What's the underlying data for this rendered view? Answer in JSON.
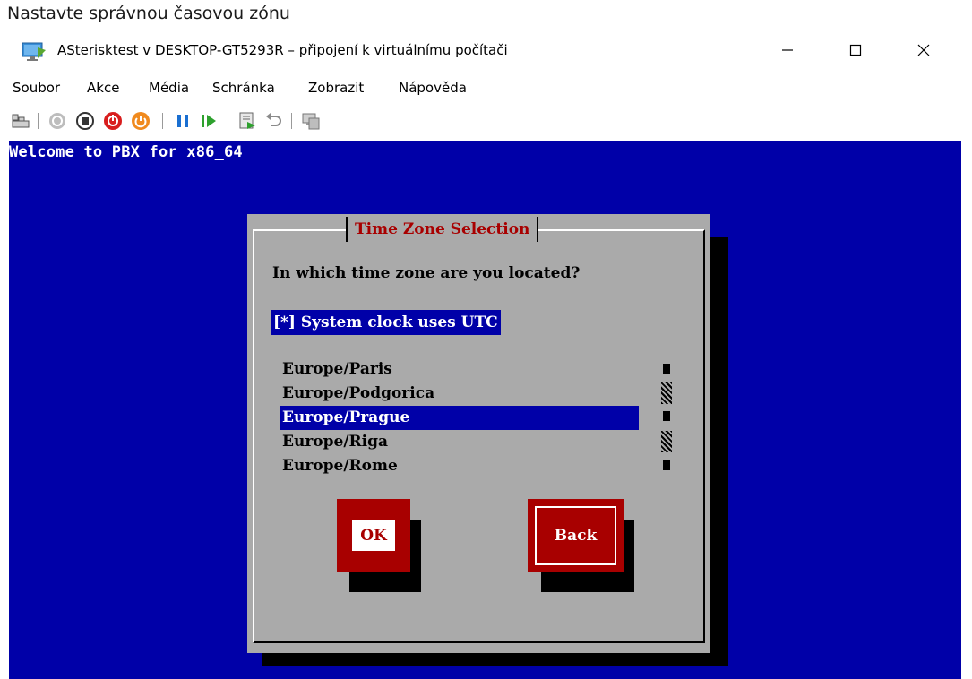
{
  "caption": "Nastavte správnou časovou zónu",
  "window": {
    "title": "ASterisktest v DESKTOP-GT5293R – připojení k virtuálnímu počítači",
    "controls": {
      "minimize": "—",
      "maximize": "☐",
      "close": "✕"
    }
  },
  "menu": [
    "Soubor",
    "Akce",
    "Média",
    "Schránka",
    "Zobrazit",
    "Nápověda"
  ],
  "toolbar": {
    "icons": [
      "ctrl-alt-del-icon",
      "start-icon",
      "turn-off-icon",
      "shutdown-icon",
      "power-icon",
      "pause-icon",
      "resume-icon",
      "checkpoint-icon",
      "revert-icon",
      "enhanced-session-icon"
    ]
  },
  "console": {
    "welcome": "Welcome to PBX for x86_64",
    "dialog": {
      "title": "Time Zone Selection",
      "question": "In which time zone are you located?",
      "utc_checkbox": "[*] System clock uses UTC",
      "timezones": [
        "Europe/Paris",
        "Europe/Podgorica",
        "Europe/Prague",
        "Europe/Riga",
        "Europe/Rome"
      ],
      "selected_index": 2,
      "ok_label": "OK",
      "back_label": "Back"
    }
  },
  "colors": {
    "console_bg": "#0000a8",
    "dialog_bg": "#aaaaaa",
    "title_red": "#a80000",
    "button_red": "#a80000"
  }
}
